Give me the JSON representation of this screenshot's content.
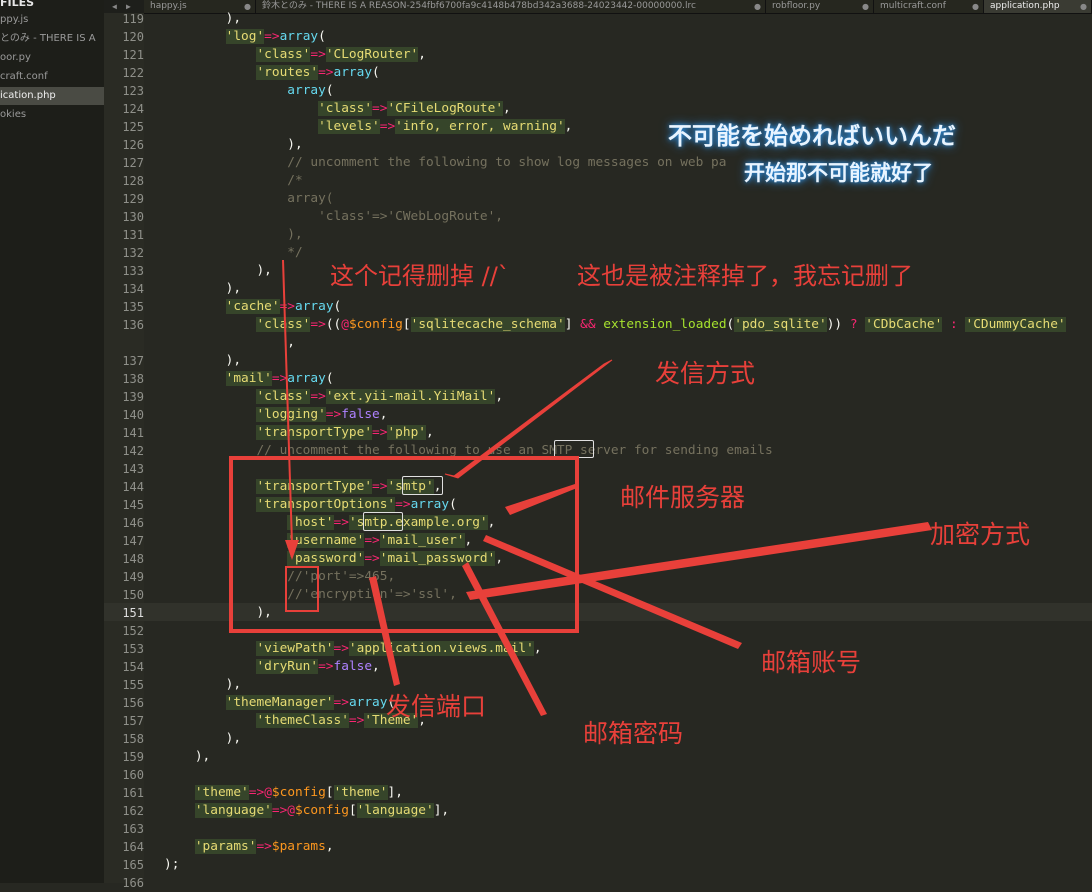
{
  "sidebar": {
    "header": "FILES",
    "items": [
      {
        "label": "ppy.js"
      },
      {
        "label": "とのみ - THERE IS A"
      },
      {
        "label": "oor.py"
      },
      {
        "label": "craft.conf"
      },
      {
        "label": "ication.php",
        "selected": true
      },
      {
        "label": "okies"
      }
    ]
  },
  "tabs": [
    {
      "label": "happy.js",
      "active": false
    },
    {
      "label": "鈴木とのみ - THERE IS A REASON-254fbf6700fa9c4148b478bd342a3688-24023442-00000000.lrc",
      "active": false
    },
    {
      "label": "robfloor.py",
      "active": false
    },
    {
      "label": "multicraft.conf",
      "active": false
    },
    {
      "label": "application.php",
      "active": true
    }
  ],
  "tab_modified_marker": "●",
  "nav": {
    "back": "◀",
    "forward": "▶"
  },
  "editor": {
    "current_line": 151,
    "lines": [
      {
        "n": "119",
        "html": "        <span class=\"w\">),</span>"
      },
      {
        "n": "120",
        "html": "        <span class=\"str q\">'log'</span><span class=\"op\">=></span><span class=\"fn\">array</span><span class=\"w\">(</span>"
      },
      {
        "n": "121",
        "html": "            <span class=\"str q\">'class'</span><span class=\"op\">=></span><span class=\"str q\">'CLogRouter'</span><span class=\"w\">,</span>"
      },
      {
        "n": "122",
        "html": "            <span class=\"str q\">'routes'</span><span class=\"op\">=></span><span class=\"fn\">array</span><span class=\"w\">(</span>"
      },
      {
        "n": "123",
        "html": "                <span class=\"fn\">array</span><span class=\"w\">(</span>"
      },
      {
        "n": "124",
        "html": "                    <span class=\"str q\">'class'</span><span class=\"op\">=></span><span class=\"str q\">'CFileLogRoute'</span><span class=\"w\">,</span>"
      },
      {
        "n": "125",
        "html": "                    <span class=\"str q\">'levels'</span><span class=\"op\">=></span><span class=\"str q\">'info, error, warning'</span><span class=\"w\">,</span>"
      },
      {
        "n": "126",
        "html": "                <span class=\"w\">),</span>"
      },
      {
        "n": "127",
        "html": "                <span class=\"cm\">// uncomment the following to show log messages on web pa</span>"
      },
      {
        "n": "128",
        "html": "                <span class=\"cm\">/*</span>"
      },
      {
        "n": "129",
        "html": "                <span class=\"cm\">array(</span>"
      },
      {
        "n": "130",
        "html": "                    <span class=\"cm\">'class'=>'CWebLogRoute',</span>"
      },
      {
        "n": "131",
        "html": "                <span class=\"cm\">),</span>"
      },
      {
        "n": "132",
        "html": "                <span class=\"cm\">*/</span>"
      },
      {
        "n": "133",
        "html": "            <span class=\"w\">),</span>"
      },
      {
        "n": "134",
        "html": "        <span class=\"w\">),</span>"
      },
      {
        "n": "135",
        "html": "        <span class=\"str q\">'cache'</span><span class=\"op\">=></span><span class=\"fn\">array</span><span class=\"w\">(</span>"
      },
      {
        "n": "136",
        "html": "            <span class=\"str q\">'class'</span><span class=\"op\">=></span><span class=\"w\">((</span><span class=\"op\">@</span><span class=\"var\">$config</span><span class=\"w\">[</span><span class=\"str q\">'sqlitecache_schema'</span><span class=\"w\">] </span><span class=\"op\">&amp;&amp;</span><span class=\"w\"> </span><span class=\"k\">extension_loaded</span><span class=\"w\">(</span><span class=\"str q\">'pdo_sqlite'</span><span class=\"w\">)) </span><span class=\"op\">?</span><span class=\"w\"> </span><span class=\"str q\">'CDbCache'</span><span class=\"w\"> </span><span class=\"op\">:</span><span class=\"w\"> </span><span class=\"str q\">'CDummyCache'</span>"
      },
      {
        "n": "",
        "html": "            <span class=\"w\">    ,</span>"
      },
      {
        "n": "137",
        "html": "        <span class=\"w\">),</span>"
      },
      {
        "n": "138",
        "html": "        <span class=\"str q\">'mail'</span><span class=\"op\">=></span><span class=\"fn\">array</span><span class=\"w\">(</span>"
      },
      {
        "n": "139",
        "html": "            <span class=\"str q\">'class'</span><span class=\"op\">=></span><span class=\"str q\">'ext.yii-mail.YiiMail'</span><span class=\"w\">,</span>"
      },
      {
        "n": "140",
        "html": "            <span class=\"str q\">'logging'</span><span class=\"op\">=></span><span class=\"bl\">false</span><span class=\"w\">,</span>"
      },
      {
        "n": "141",
        "html": "            <span class=\"str q\">'transportType'</span><span class=\"op\">=></span><span class=\"str q\">'php'</span><span class=\"w\">,</span>"
      },
      {
        "n": "142",
        "html": "            <span class=\"cm\">// uncomment the following to use an SMTP server for sending emails</span>"
      },
      {
        "n": "143",
        "html": ""
      },
      {
        "n": "144",
        "html": "            <span class=\"str q\">'transportType'</span><span class=\"op\">=></span><span class=\"str q\">'smtp'</span><span class=\"w\">,</span>"
      },
      {
        "n": "145",
        "html": "            <span class=\"str q\">'transportOptions'</span><span class=\"op\">=></span><span class=\"fn\">array</span><span class=\"w\">(</span>"
      },
      {
        "n": "146",
        "html": "                <span class=\"str q\">'host'</span><span class=\"op\">=></span><span class=\"str q\">'smtp.example.org'</span><span class=\"w\">,</span>"
      },
      {
        "n": "147",
        "html": "                <span class=\"str q\">'username'</span><span class=\"op\">=></span><span class=\"str q\">'mail_user'</span><span class=\"w\">,</span>"
      },
      {
        "n": "148",
        "html": "                <span class=\"str q\">'password'</span><span class=\"op\">=></span><span class=\"str q\">'mail_password'</span><span class=\"w\">,</span>"
      },
      {
        "n": "149",
        "html": "                <span class=\"cm\">//'port'=>465,</span>"
      },
      {
        "n": "150",
        "html": "                <span class=\"cm\">//'encryption'=>'ssl',</span>"
      },
      {
        "n": "151",
        "html": "            <span class=\"w\">),</span>"
      },
      {
        "n": "152",
        "html": ""
      },
      {
        "n": "153",
        "html": "            <span class=\"str q\">'viewPath'</span><span class=\"op\">=></span><span class=\"str q\">'application.views.mail'</span><span class=\"w\">,</span>"
      },
      {
        "n": "154",
        "html": "            <span class=\"str q\">'dryRun'</span><span class=\"op\">=></span><span class=\"bl\">false</span><span class=\"w\">,</span>"
      },
      {
        "n": "155",
        "html": "        <span class=\"w\">),</span>"
      },
      {
        "n": "156",
        "html": "        <span class=\"str q\">'themeManager'</span><span class=\"op\">=></span><span class=\"fn\">array</span><span class=\"w\">(</span>"
      },
      {
        "n": "157",
        "html": "            <span class=\"str q\">'themeClass'</span><span class=\"op\">=></span><span class=\"str q\">'Theme'</span><span class=\"w\">,</span>"
      },
      {
        "n": "158",
        "html": "        <span class=\"w\">),</span>"
      },
      {
        "n": "159",
        "html": "    <span class=\"w\">),</span>"
      },
      {
        "n": "160",
        "html": ""
      },
      {
        "n": "161",
        "html": "    <span class=\"str q\">'theme'</span><span class=\"op\">=></span><span class=\"op\">@</span><span class=\"var\">$config</span><span class=\"w\">[</span><span class=\"str q\">'theme'</span><span class=\"w\">],</span>"
      },
      {
        "n": "162",
        "html": "    <span class=\"str q\">'language'</span><span class=\"op\">=></span><span class=\"op\">@</span><span class=\"var\">$config</span><span class=\"w\">[</span><span class=\"str q\">'language'</span><span class=\"w\">],</span>"
      },
      {
        "n": "163",
        "html": ""
      },
      {
        "n": "164",
        "html": "    <span class=\"str q\">'params'</span><span class=\"op\">=></span><span class=\"var\">$params</span><span class=\"w\">,</span>"
      },
      {
        "n": "165",
        "html": "<span class=\"w\">);</span>"
      },
      {
        "n": "166",
        "html": ""
      }
    ]
  },
  "overlay": {
    "jp_title": "不可能を始めればいいんだ",
    "cn_subtitle": "开始那不可能就好了"
  },
  "annotations": {
    "delete_note": "这个记得删掉 //`",
    "forgot_note": "这也是被注释掉了，我忘记删了",
    "send_method": "发信方式",
    "mail_server": "邮件服务器",
    "encryption": "加密方式",
    "mail_account": "邮箱账号",
    "send_port": "发信端口",
    "mail_password": "邮箱密码"
  },
  "colors": {
    "annotation_red": "#e8403a",
    "editor_bg": "#272822",
    "keyword_green": "#a6e22e",
    "string_yellow": "#e6db74",
    "operator_pink": "#f92672",
    "function_cyan": "#66d9ef",
    "variable_orange": "#fd971f",
    "comment_gray": "#75715e"
  }
}
